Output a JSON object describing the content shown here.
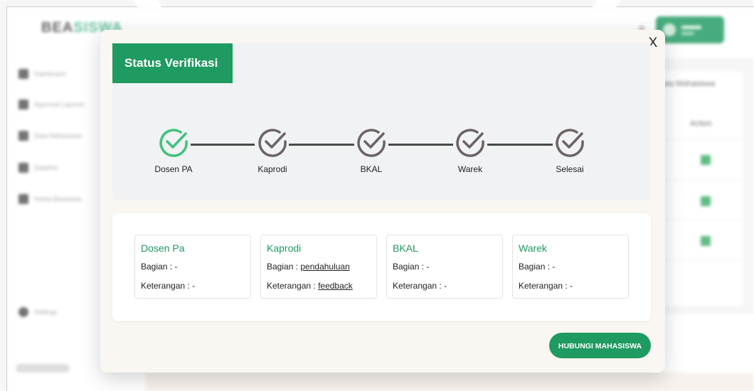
{
  "background_app": {
    "brand": {
      "prefix": "BEA",
      "accent": "SISWA"
    },
    "sidebar": {
      "items": [
        "Dashboard",
        "Approval Laporan",
        "Data Mahasiswa",
        "Dataline",
        "Kelola Beasiswa"
      ],
      "settings": "Settings"
    },
    "card": {
      "title": "Data Mahasiswa",
      "column_action": "Action"
    }
  },
  "modal": {
    "title": "Status Verifikasi",
    "close_label": "X",
    "steps": [
      {
        "label": "Dosen PA",
        "status": "complete"
      },
      {
        "label": "Kaprodi",
        "status": "pending"
      },
      {
        "label": "BKAL",
        "status": "pending"
      },
      {
        "label": "Warek",
        "status": "pending"
      },
      {
        "label": "Selesai",
        "status": "pending"
      }
    ],
    "details": [
      {
        "title": "Dosen Pa",
        "bagian_label": "Bagian : ",
        "bagian_value": "-",
        "keterangan_label": "Keterangan : ",
        "keterangan_value": "-"
      },
      {
        "title": "Kaprodi",
        "bagian_label": "Bagian : ",
        "bagian_value": "pendahuluan",
        "keterangan_label": "Keterangan : ",
        "keterangan_value": "feedback"
      },
      {
        "title": "BKAL",
        "bagian_label": "Bagian : ",
        "bagian_value": "-",
        "keterangan_label": "Keterangan : ",
        "keterangan_value": "-"
      },
      {
        "title": "Warek",
        "bagian_label": "Bagian : ",
        "bagian_value": "-",
        "keterangan_label": "Keterangan : ",
        "keterangan_value": "-"
      }
    ],
    "contact_button": "HUBUNGI MAHASISWA"
  },
  "colors": {
    "primary": "#1f9a61",
    "step_complete": "#3fc27a",
    "step_pending": "#6b6366",
    "connector": "#4a4a4a"
  }
}
